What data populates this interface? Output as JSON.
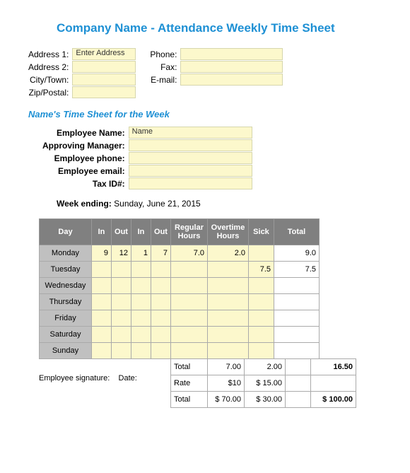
{
  "title": "Company Name - Attendance Weekly Time Sheet",
  "company": {
    "labels": {
      "addr1": "Address 1:",
      "addr2": "Address 2:",
      "city": "City/Town:",
      "zip": "Zip/Postal:",
      "phone": "Phone:",
      "fax": "Fax:",
      "email": "E-mail:"
    },
    "values": {
      "addr1": "Enter Address",
      "addr2": "",
      "city": "",
      "zip": "",
      "phone": "",
      "fax": "",
      "email": ""
    }
  },
  "subtitle": "Name's Time Sheet for the Week",
  "employee": {
    "labels": {
      "name": "Employee Name:",
      "manager": "Approving Manager:",
      "phone": "Employee phone:",
      "email": "Employee email:",
      "tax": "Tax ID#:"
    },
    "values": {
      "name": "Name",
      "manager": "",
      "phone": "",
      "email": "",
      "tax": ""
    }
  },
  "week": {
    "label": "Week ending:",
    "value": "Sunday, June 21, 2015"
  },
  "headers": {
    "day": "Day",
    "in": "In",
    "out": "Out",
    "reg": "Regular Hours",
    "ot": "Overtime Hours",
    "sick": "Sick",
    "total": "Total"
  },
  "rows": [
    {
      "day": "Monday",
      "in1": "9",
      "out1": "12",
      "in2": "1",
      "out2": "7",
      "reg": "7.0",
      "ot": "2.0",
      "sick": "",
      "total": "9.0"
    },
    {
      "day": "Tuesday",
      "in1": "",
      "out1": "",
      "in2": "",
      "out2": "",
      "reg": "",
      "ot": "",
      "sick": "7.5",
      "total": "7.5"
    },
    {
      "day": "Wednesday",
      "in1": "",
      "out1": "",
      "in2": "",
      "out2": "",
      "reg": "",
      "ot": "",
      "sick": "",
      "total": ""
    },
    {
      "day": "Thursday",
      "in1": "",
      "out1": "",
      "in2": "",
      "out2": "",
      "reg": "",
      "ot": "",
      "sick": "",
      "total": ""
    },
    {
      "day": "Friday",
      "in1": "",
      "out1": "",
      "in2": "",
      "out2": "",
      "reg": "",
      "ot": "",
      "sick": "",
      "total": ""
    },
    {
      "day": "Saturday",
      "in1": "",
      "out1": "",
      "in2": "",
      "out2": "",
      "reg": "",
      "ot": "",
      "sick": "",
      "total": ""
    },
    {
      "day": "Sunday",
      "in1": "",
      "out1": "",
      "in2": "",
      "out2": "",
      "reg": "",
      "ot": "",
      "sick": "",
      "total": ""
    }
  ],
  "totals": {
    "labels": {
      "total": "Total",
      "rate": "Rate"
    },
    "hours": {
      "reg": "7.00",
      "ot": "2.00",
      "sick": "",
      "grand": "16.50"
    },
    "rate": {
      "reg": "$10",
      "ot": "$    15.00",
      "sick": "",
      "grand": ""
    },
    "pay": {
      "reg": "$  70.00",
      "ot": "$    30.00",
      "sick": "",
      "grand": "$  100.00"
    }
  },
  "signature": {
    "emp": "Employee signature:",
    "date": "Date:"
  },
  "chart_data": {
    "type": "table",
    "columns": [
      "Day",
      "In",
      "Out",
      "In",
      "Out",
      "Regular Hours",
      "Overtime Hours",
      "Sick",
      "Total"
    ],
    "rows": [
      [
        "Monday",
        9,
        12,
        1,
        7,
        7.0,
        2.0,
        null,
        9.0
      ],
      [
        "Tuesday",
        null,
        null,
        null,
        null,
        null,
        null,
        7.5,
        7.5
      ],
      [
        "Wednesday",
        null,
        null,
        null,
        null,
        null,
        null,
        null,
        null
      ],
      [
        "Thursday",
        null,
        null,
        null,
        null,
        null,
        null,
        null,
        null
      ],
      [
        "Friday",
        null,
        null,
        null,
        null,
        null,
        null,
        null,
        null
      ],
      [
        "Saturday",
        null,
        null,
        null,
        null,
        null,
        null,
        null,
        null
      ],
      [
        "Sunday",
        null,
        null,
        null,
        null,
        null,
        null,
        null,
        null
      ]
    ],
    "summary": {
      "total_hours": {
        "regular": 7.0,
        "overtime": 2.0,
        "sick": null,
        "grand": 16.5
      },
      "rate": {
        "regular": 10,
        "overtime": 15.0
      },
      "total_pay": {
        "regular": 70.0,
        "overtime": 30.0,
        "grand": 100.0
      }
    }
  }
}
